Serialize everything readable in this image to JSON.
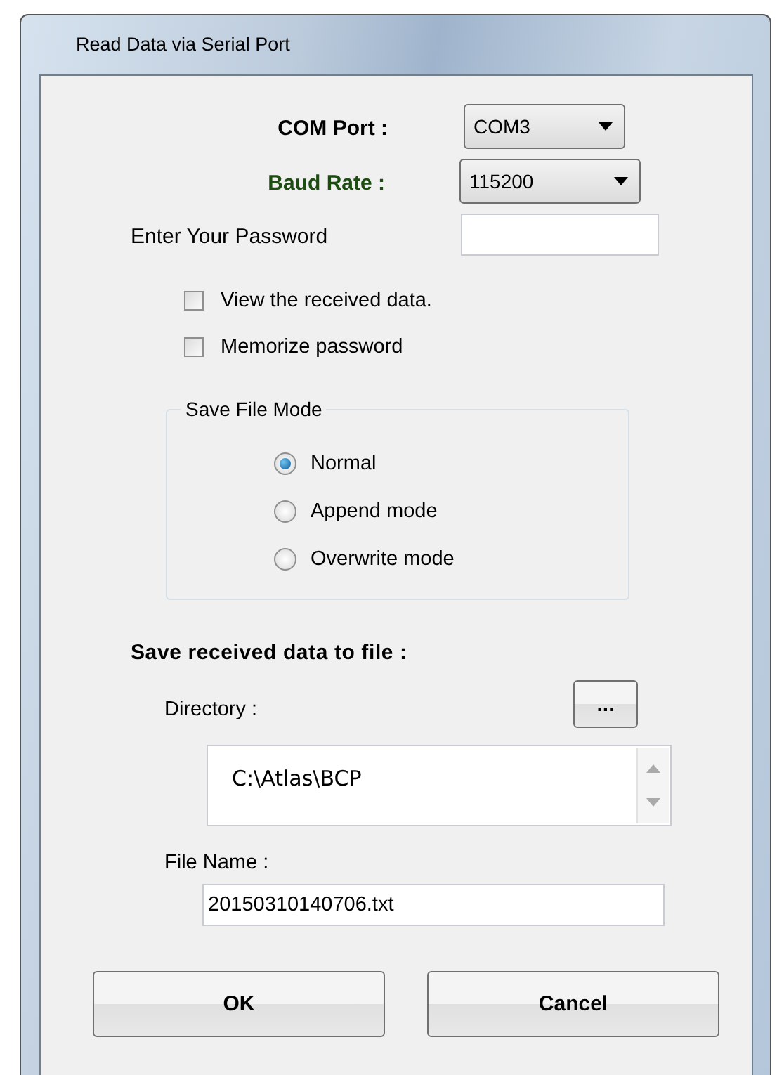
{
  "window": {
    "title": "Read Data via Serial Port"
  },
  "com_port": {
    "label": "COM Port :",
    "value": "COM3"
  },
  "baud_rate": {
    "label": "Baud Rate :",
    "value": "115200",
    "color": "#1e4d12"
  },
  "password": {
    "label": "Enter Your Password"
  },
  "checkboxes": [
    {
      "label": "View the received data.",
      "checked": false
    },
    {
      "label": "Memorize password",
      "checked": false
    }
  ],
  "save_file_mode": {
    "title": "Save File Mode",
    "options": [
      {
        "label": "Normal",
        "selected": true
      },
      {
        "label": "Append mode",
        "selected": false
      },
      {
        "label": "Overwrite mode",
        "selected": false
      }
    ]
  },
  "save_section": {
    "title": "Save received data to file :",
    "directory_label": "Directory :",
    "browse_button": "...",
    "directory": "C:\\Atlas\\BCP",
    "file_name_label": "File Name :",
    "file_name": "20150310140706.txt"
  },
  "buttons": [
    "OK",
    "Cancel"
  ]
}
